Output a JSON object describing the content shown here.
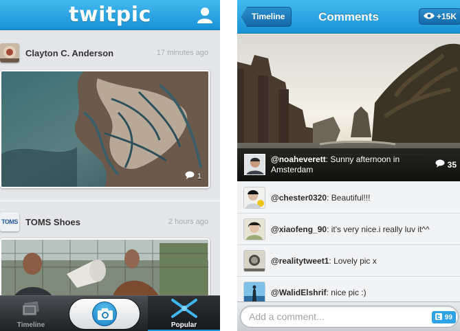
{
  "left_screen": {
    "header": {
      "logo_text": "twitpic",
      "profile_icon": "user-icon"
    },
    "posts": [
      {
        "user": "Clayton C. Anderson",
        "time": "17 minutes ago",
        "comment_count": "1"
      },
      {
        "user": "TOMS Shoes",
        "time": "2 hours ago",
        "avatar_text": "TOMS"
      }
    ],
    "tabbar": {
      "timeline_label": "Timeline",
      "popular_label": "Popular",
      "camera_icon": "camera-icon"
    }
  },
  "right_screen": {
    "header": {
      "back_label": "Timeline",
      "title": "Comments",
      "views": "+15K"
    },
    "photo": {
      "caption_user": "@noaheverett",
      "caption_text": ": Sunny afternoon in Amsterdam",
      "comment_count": "35"
    },
    "comments": [
      {
        "user": "@chester0320",
        "text": ": Beautiful!!!"
      },
      {
        "user": "@xiaofeng_90",
        "text": ": it's very nice.i really luv it^^"
      },
      {
        "user": "@realitytweet1",
        "text": ": Lovely pic x"
      },
      {
        "user": "@WalidElshrif",
        "text": ": nice pic :)"
      }
    ],
    "comment_input": {
      "placeholder": "Add a comment...",
      "char_count": "99"
    }
  },
  "colors": {
    "brand_blue": "#1a93d6",
    "tabbar_dark": "#1e2023"
  }
}
